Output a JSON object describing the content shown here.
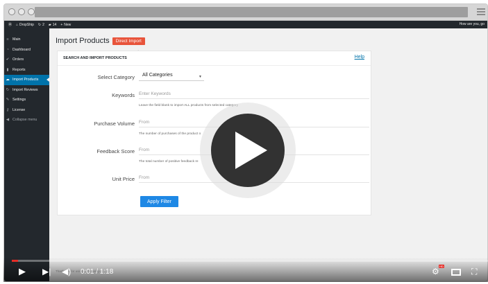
{
  "admin_bar": {
    "wp_icon": "wordpress-icon",
    "site": "DropShip",
    "updates_count": "2",
    "comments_count": "14",
    "new_label": "New",
    "greeting": "How are you, go"
  },
  "sidebar": {
    "items": [
      {
        "label": "Main",
        "icon": "menu-icon"
      },
      {
        "label": "Dashboard",
        "icon": "dashboard-icon"
      },
      {
        "label": "Orders",
        "icon": "check-icon"
      },
      {
        "label": "Reports",
        "icon": "bar-chart-icon"
      },
      {
        "label": "Import Products",
        "icon": "cloud-icon"
      },
      {
        "label": "Import Reviews",
        "icon": "refresh-icon"
      },
      {
        "label": "Settings",
        "icon": "wrench-icon"
      },
      {
        "label": "License",
        "icon": "key-icon"
      },
      {
        "label": "Collapse menu",
        "icon": "collapse-icon"
      }
    ]
  },
  "page": {
    "title": "Import Products",
    "direct_import_label": "Direct Import"
  },
  "panel": {
    "title": "SEARCH AND IMPORT PRODUCTS",
    "help": "Help",
    "category_label": "Select Category",
    "category_value": "All Categories",
    "keywords_label": "Keywords",
    "keywords_placeholder": "Enter Keywords",
    "keywords_hint": "Leave the field blank to import ALL products from selected category",
    "volume_label": "Purchase Volume",
    "volume_placeholder": "From",
    "volume_hint": "The number of purchases of the product o",
    "feedback_label": "Feedback Score",
    "feedback_placeholder": "From",
    "feedback_hint": "The total number of positive feedback re",
    "price_label": "Unit Price",
    "price_placeholder": "From",
    "apply_label": "Apply Filter"
  },
  "footer_note": "Thank you for using ... Dropship",
  "video": {
    "time": "0:01 / 1:18",
    "progress": 0.013,
    "hd_label": "HD",
    "accent": "#e52d27"
  }
}
